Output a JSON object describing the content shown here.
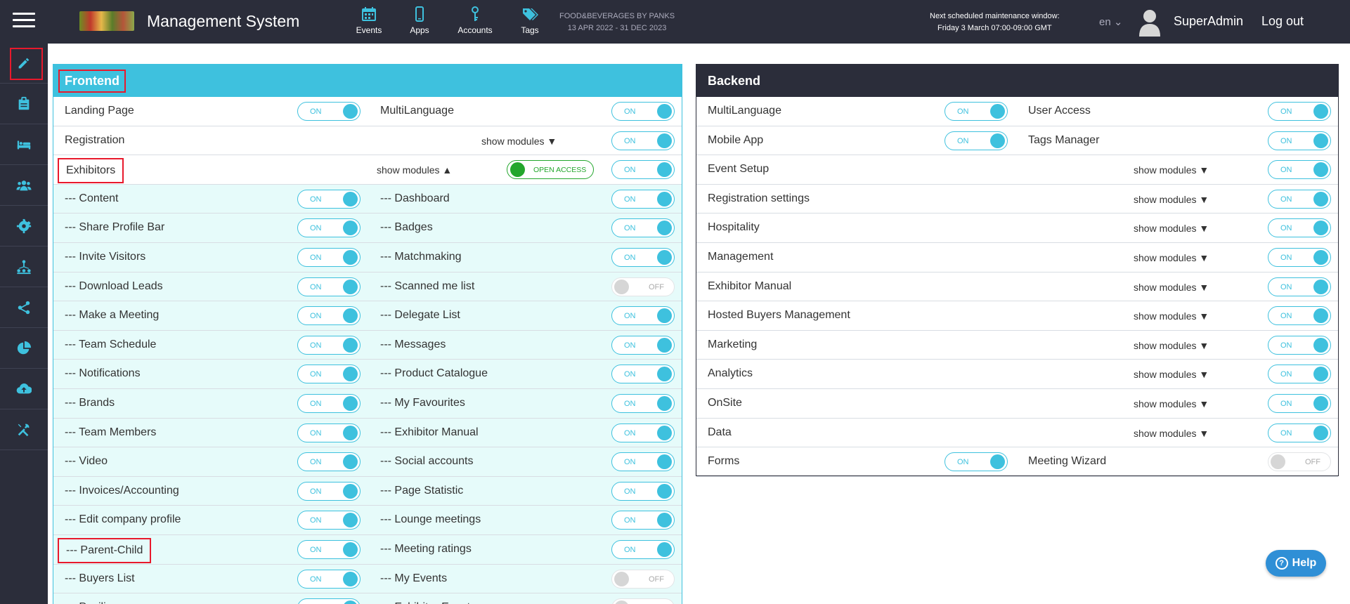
{
  "header": {
    "app_title": "Management System",
    "nav": [
      {
        "label": "Events",
        "icon": "calendar-icon"
      },
      {
        "label": "Apps",
        "icon": "mobile-icon"
      },
      {
        "label": "Accounts",
        "icon": "key-icon"
      },
      {
        "label": "Tags",
        "icon": "tags-icon"
      }
    ],
    "event_name": "FOOD&BEVERAGES BY PANKS",
    "event_dates": "13 APR 2022 - 31 DEC 2023",
    "maintenance_line1": "Next scheduled maintenance window:",
    "maintenance_line2": "Friday 3 March 07:00-09:00 GMT",
    "lang": "en",
    "username": "SuperAdmin",
    "logout": "Log out"
  },
  "sidebar": {
    "items": [
      {
        "icon": "pencil-icon",
        "selected": true
      },
      {
        "icon": "clipboard-icon"
      },
      {
        "icon": "bed-icon"
      },
      {
        "icon": "users-icon"
      },
      {
        "icon": "gear-icon"
      },
      {
        "icon": "hierarchy-icon"
      },
      {
        "icon": "share-icon"
      },
      {
        "icon": "pie-chart-icon"
      },
      {
        "icon": "cloud-upload-icon"
      },
      {
        "icon": "tools-icon"
      }
    ]
  },
  "toggle": {
    "on": "ON",
    "off": "OFF"
  },
  "frontend": {
    "title": "Frontend",
    "show_modules": "show modules",
    "open_access": "OPEN ACCESS",
    "rows": [
      {
        "left": "Landing Page",
        "left_on": true,
        "right": "MultiLanguage",
        "right_on": true
      },
      {
        "left": "Registration",
        "show_modules": "down",
        "right_on": true
      },
      {
        "left": "Exhibitors",
        "show_modules": "up",
        "open_access": true,
        "right_on": true,
        "highlight": true
      },
      {
        "left": "--- Content",
        "left_on": true,
        "right": "--- Dashboard",
        "right_on": true,
        "sub": true
      },
      {
        "left": "--- Share Profile Bar",
        "left_on": true,
        "right": "--- Badges",
        "right_on": true,
        "sub": true
      },
      {
        "left": "--- Invite Visitors",
        "left_on": true,
        "right": "--- Matchmaking",
        "right_on": true,
        "sub": true
      },
      {
        "left": "--- Download Leads",
        "left_on": true,
        "right": "--- Scanned me list",
        "right_on": false,
        "sub": true
      },
      {
        "left": "--- Make a Meeting",
        "left_on": true,
        "right": "--- Delegate List",
        "right_on": true,
        "sub": true
      },
      {
        "left": "--- Team Schedule",
        "left_on": true,
        "right": "--- Messages",
        "right_on": true,
        "sub": true
      },
      {
        "left": "--- Notifications",
        "left_on": true,
        "right": "--- Product Catalogue",
        "right_on": true,
        "sub": true
      },
      {
        "left": "--- Brands",
        "left_on": true,
        "right": "--- My Favourites",
        "right_on": true,
        "sub": true
      },
      {
        "left": "--- Team Members",
        "left_on": true,
        "right": "--- Exhibitor Manual",
        "right_on": true,
        "sub": true
      },
      {
        "left": "--- Video",
        "left_on": true,
        "right": "--- Social accounts",
        "right_on": true,
        "sub": true
      },
      {
        "left": "--- Invoices/Accounting",
        "left_on": true,
        "right": "--- Page Statistic",
        "right_on": true,
        "sub": true
      },
      {
        "left": "--- Edit company profile",
        "left_on": true,
        "right": "--- Lounge meetings",
        "right_on": true,
        "sub": true
      },
      {
        "left": "--- Parent-Child",
        "left_on": true,
        "right": "--- Meeting ratings",
        "right_on": true,
        "sub": true,
        "highlight": true
      },
      {
        "left": "--- Buyers List",
        "left_on": true,
        "right": "--- My Events",
        "right_on": false,
        "sub": true
      },
      {
        "left": "--- Pavilions",
        "left_on": true,
        "right": "--- Exhibitor Events",
        "right_on": false,
        "sub": true
      }
    ]
  },
  "backend": {
    "title": "Backend",
    "show_modules": "show modules",
    "rows": [
      {
        "left": "MultiLanguage",
        "left_on": true,
        "right": "User Access",
        "right_on": true
      },
      {
        "left": "Mobile App",
        "left_on": true,
        "right": "Tags Manager",
        "right_on": true
      },
      {
        "left": "Event Setup",
        "show_modules": "down",
        "right_on": true
      },
      {
        "left": "Registration settings",
        "show_modules": "down",
        "right_on": true
      },
      {
        "left": "Hospitality",
        "show_modules": "down",
        "right_on": true
      },
      {
        "left": "Management",
        "show_modules": "down",
        "right_on": true
      },
      {
        "left": "Exhibitor Manual",
        "show_modules": "down",
        "right_on": true
      },
      {
        "left": "Hosted Buyers Management",
        "show_modules": "down",
        "right_on": true
      },
      {
        "left": "Marketing",
        "show_modules": "down",
        "right_on": true
      },
      {
        "left": "Analytics",
        "show_modules": "down",
        "right_on": true
      },
      {
        "left": "OnSite",
        "show_modules": "down",
        "right_on": true
      },
      {
        "left": "Data",
        "show_modules": "down",
        "right_on": true
      },
      {
        "left": "Forms",
        "left_on": true,
        "right": "Meeting Wizard",
        "right_on": false
      }
    ]
  },
  "help": {
    "label": "Help"
  },
  "colors": {
    "accent": "#3ec1de",
    "dark": "#2b2d3a",
    "highlight": "#e8192c",
    "open_access": "#23a62c"
  }
}
